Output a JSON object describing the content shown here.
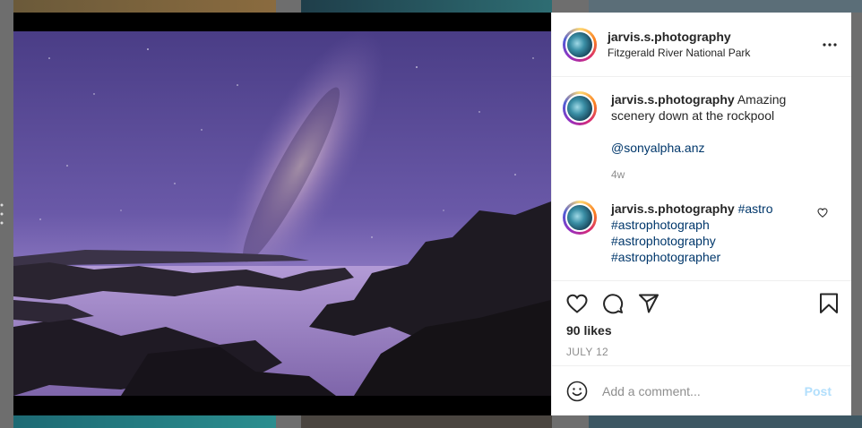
{
  "post": {
    "username": "jarvis.s.photography",
    "location": "Fitzgerald River National Park"
  },
  "caption": {
    "username": "jarvis.s.photography",
    "text": "Amazing scenery down at the rockpool",
    "mention": "@sonyalpha.anz",
    "age": "4w"
  },
  "hashtag_comment": {
    "username": "jarvis.s.photography",
    "tags": [
      "#astro",
      "#astrophotograph",
      "#astrophotography",
      "#astrophotographer"
    ]
  },
  "stats": {
    "likes": "90 likes",
    "date": "JULY 12"
  },
  "composer": {
    "placeholder": "Add a comment...",
    "post_label": "Post"
  },
  "icons": {
    "more": "more-horizontal-icon",
    "like": "heart-icon",
    "comment": "speech-bubble-icon",
    "share": "paper-plane-icon",
    "save": "bookmark-icon",
    "emoji": "smiley-icon"
  }
}
